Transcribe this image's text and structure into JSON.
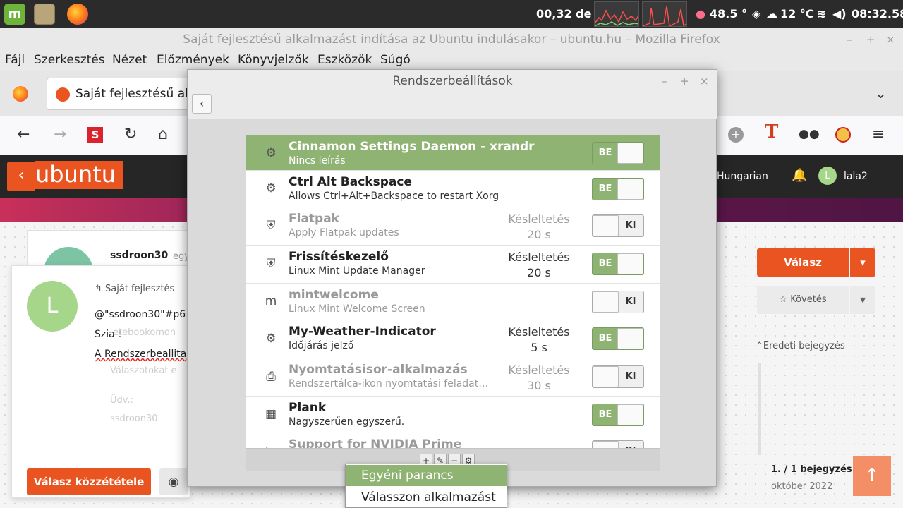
{
  "panel": {
    "cpu_text": "00,32 de",
    "temp": "48.5 °",
    "weather": "12 °C",
    "clock": "08:32.58"
  },
  "firefox": {
    "window_title": "Saját fejlesztésű alkalmazást indítása az Ubuntu indulásakor – ubuntu.hu – Mozilla Firefox",
    "menu": [
      "Fájl",
      "Szerkesztés",
      "Nézet",
      "Előzmények",
      "Könyvjelzők",
      "Eszközök",
      "Súgó"
    ],
    "tab_title": "Saját fejlesztésű al"
  },
  "forum": {
    "logo": "ubuntu",
    "language": "Hungarian",
    "username": "lala2",
    "user_initial": "L",
    "post_author": "ssdroon30",
    "post_author_suffix": "egy",
    "reply_to": "Saját fejlesztés",
    "reply_lines": [
      "@\"ssdroon30\"#p6",
      "Szia !",
      "A Rendszerbeallita"
    ],
    "bg_lines": [
      "etebookomon",
      "Válaszotokat e",
      "Üdv.:",
      "ssdroon30"
    ],
    "reply_button": "Válasz",
    "follow_button": "Követés",
    "original_post": "Eredeti bejegyzés",
    "submit_button": "Válasz közzététele",
    "pager": "1. / 1 bejegyzés",
    "date": "október 2022"
  },
  "dialog": {
    "title": "Rendszerbeállítások",
    "rows": [
      {
        "name": "Cinnamon Settings Daemon - xrandr",
        "desc": "Nincs leírás",
        "delay_label": "",
        "delay": "",
        "state": "BE",
        "on": true,
        "disabled": false,
        "selected": true,
        "icon": "gear-icon"
      },
      {
        "name": "Ctrl Alt Backspace",
        "desc": "Allows Ctrl+Alt+Backspace to restart Xorg",
        "delay_label": "",
        "delay": "",
        "state": "BE",
        "on": true,
        "disabled": false,
        "selected": false,
        "icon": "gear-icon"
      },
      {
        "name": "Flatpak",
        "desc": "Apply Flatpak updates",
        "delay_label": "Késleltetés",
        "delay": "20 s",
        "state": "KI",
        "on": false,
        "disabled": true,
        "selected": false,
        "icon": "shield-icon"
      },
      {
        "name": "Frissítéskezelő",
        "desc": "Linux Mint Update Manager",
        "delay_label": "Késleltetés",
        "delay": "20 s",
        "state": "BE",
        "on": true,
        "disabled": false,
        "selected": false,
        "icon": "shield-icon"
      },
      {
        "name": "mintwelcome",
        "desc": "Linux Mint Welcome Screen",
        "delay_label": "",
        "delay": "",
        "state": "KI",
        "on": false,
        "disabled": true,
        "selected": false,
        "icon": "mint-icon"
      },
      {
        "name": "My-Weather-Indicator",
        "desc": "Időjárás jelző",
        "delay_label": "Késleltetés",
        "delay": "5 s",
        "state": "BE",
        "on": true,
        "disabled": false,
        "selected": false,
        "icon": "gear-icon"
      },
      {
        "name": "Nyomtatásisor-alkalmazás",
        "desc": "Rendszertálca-ikon nyomtatási feladat…",
        "delay_label": "Késleltetés",
        "delay": "30 s",
        "state": "KI",
        "on": false,
        "disabled": true,
        "selected": false,
        "icon": "printer-icon"
      },
      {
        "name": "Plank",
        "desc": "Nagyszerűen egyszerű.",
        "delay_label": "",
        "delay": "",
        "state": "BE",
        "on": true,
        "disabled": false,
        "selected": false,
        "icon": "dock-icon"
      },
      {
        "name": "Support for NVIDIA Prime",
        "desc": "",
        "delay_label": "",
        "delay": "",
        "state": "KI",
        "on": false,
        "disabled": true,
        "selected": false,
        "icon": "nvidia-icon"
      }
    ],
    "toolbar": {
      "add": "+",
      "edit": "✎",
      "remove": "−",
      "settings": "⚙"
    }
  },
  "popup": {
    "items": [
      "Egyéni parancs",
      "Válasszon alkalmazást"
    ]
  }
}
